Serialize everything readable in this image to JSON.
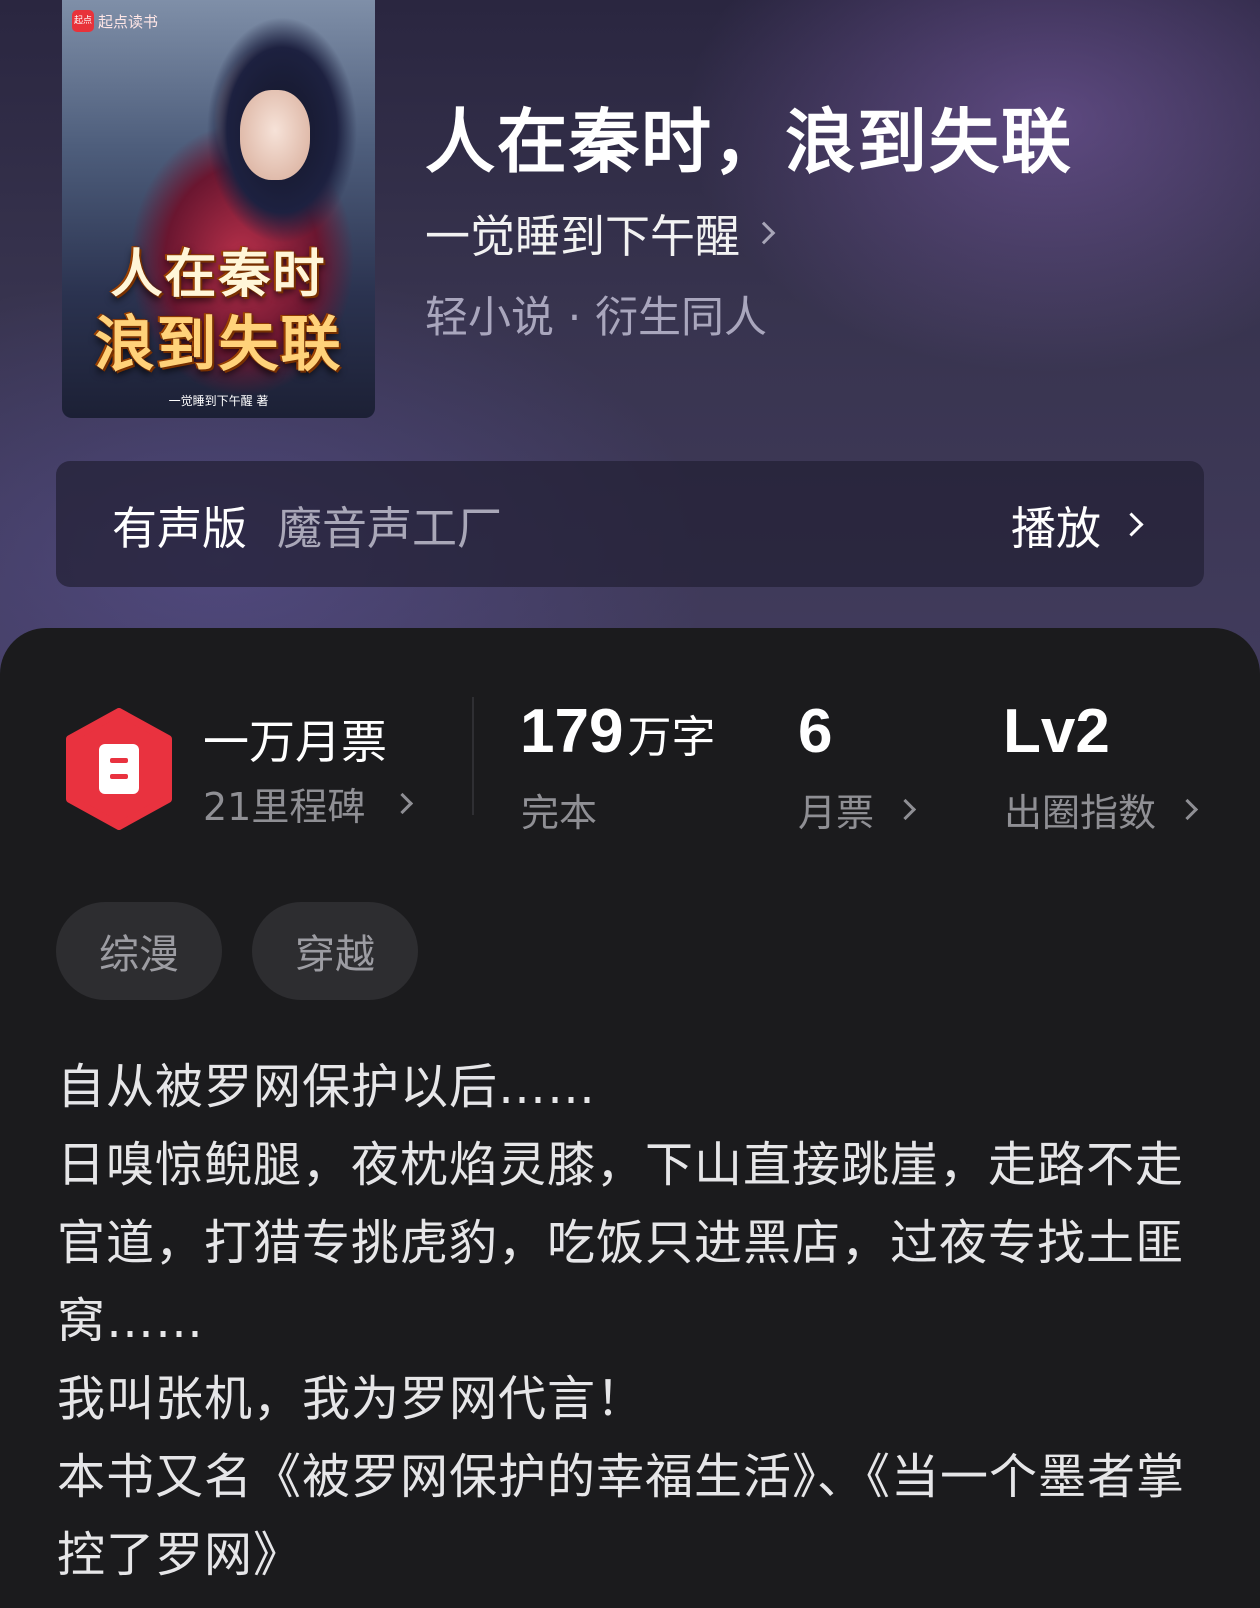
{
  "cover": {
    "brand": "起点读书",
    "brand_logo": "起点",
    "title_line1": "人在秦时",
    "title_line2": "浪到失联",
    "author_tag": "一觉睡到下午醒 著"
  },
  "book": {
    "title": "人在秦时，浪到失联",
    "author": "一觉睡到下午醒",
    "genre": "轻小说 · 衍生同人"
  },
  "audio": {
    "label": "有声版",
    "studio": "魔音声工厂",
    "play_label": "播放"
  },
  "stats": {
    "ticket_badge": "一万月票",
    "milestones": "21里程碑",
    "word_count": "179",
    "word_unit": "万字",
    "status": "完本",
    "monthly_tickets": "6",
    "monthly_tickets_label": "月票",
    "level": "Lv2",
    "level_label": "出圈指数"
  },
  "tags": [
    "综漫",
    "穿越"
  ],
  "description": [
    "自从被罗网保护以后……",
    "日嗅惊鲵腿，夜枕焰灵膝，下山直接跳崖，走路不走官道，打猎专挑虎豹，吃饭只进黑店，过夜专找土匪窝……",
    "我叫张机，我为罗网代言！",
    "本书又名《被罗网保护的幸福生活》、《当一个墨者掌控了罗网》"
  ],
  "colors": {
    "accent": "#e9323f",
    "card_bg": "#1b1b1d",
    "muted_text": "#8f8f94"
  },
  "icons": {
    "ticket": "monthly-ticket-icon",
    "chevron": "chevron-right-icon"
  }
}
